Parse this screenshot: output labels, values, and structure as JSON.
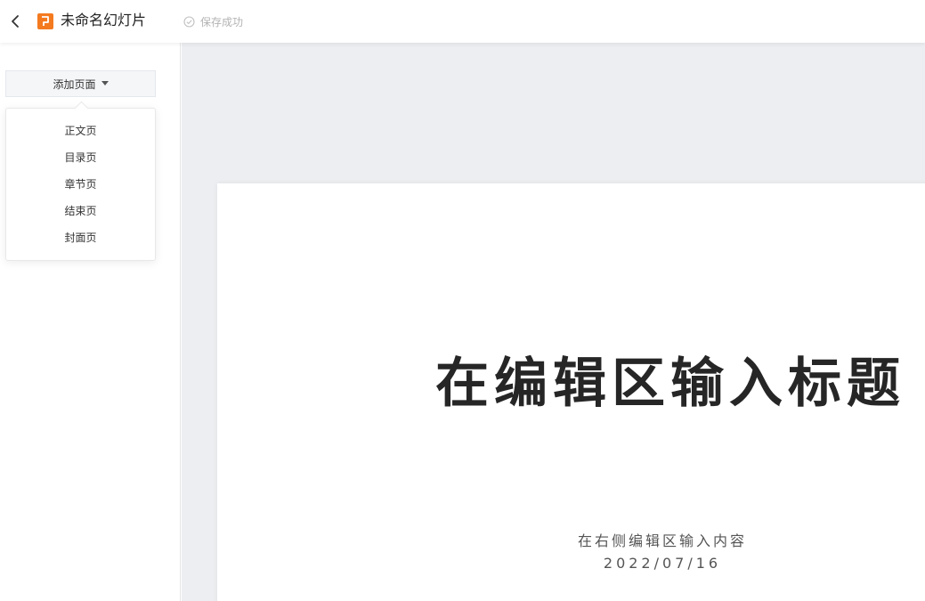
{
  "header": {
    "title": "未命名幻灯片",
    "save_status": "保存成功",
    "back_icon": "chevron-left-icon",
    "logo_icon": "presentation-logo-icon",
    "save_icon": "check-circle-icon",
    "accent_color": "#f47a20"
  },
  "sidebar": {
    "add_page_label": "添加页面",
    "add_page_icon": "caret-down-icon",
    "menu_items": [
      {
        "label": "正文页"
      },
      {
        "label": "目录页"
      },
      {
        "label": "章节页"
      },
      {
        "label": "结束页"
      },
      {
        "label": "封面页"
      }
    ]
  },
  "slide": {
    "title": "在编辑区输入标题",
    "subtitle": "在右侧编辑区输入内容",
    "date": "2022/07/16"
  }
}
